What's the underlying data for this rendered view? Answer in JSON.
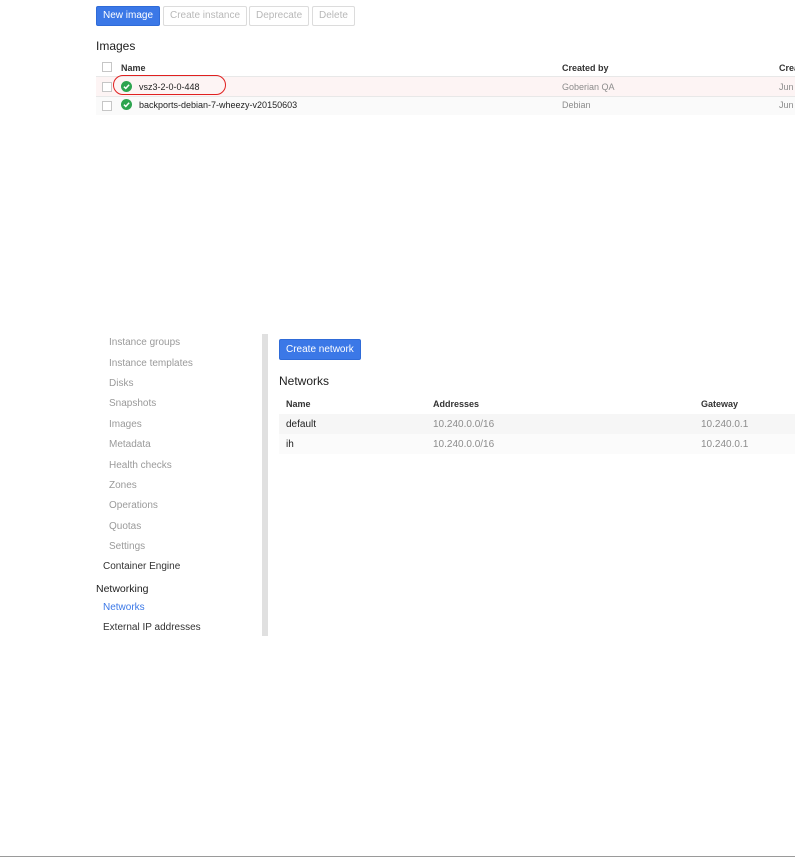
{
  "images_panel": {
    "toolbar": {
      "new_image": "New image",
      "create_instance": "Create instance",
      "deprecate": "Deprecate",
      "delete": "Delete"
    },
    "title": "Images",
    "columns": [
      "Name",
      "Created by",
      "Crea"
    ],
    "rows": [
      {
        "name": "vsz3-2-0-0-448",
        "created_by": "Goberian QA",
        "created": "Jun",
        "status": "ready"
      },
      {
        "name": "backports-debian-7-wheezy-v20150603",
        "created_by": "Debian",
        "created": "Jun",
        "status": "ready"
      }
    ]
  },
  "networking_panel": {
    "sidebar": {
      "compute_items": [
        "Instance groups",
        "Instance templates",
        "Disks",
        "Snapshots",
        "Images",
        "Metadata",
        "Health checks",
        "Zones",
        "Operations",
        "Quotas",
        "Settings"
      ],
      "container_engine": "Container Engine",
      "networking_header": "Networking",
      "networks": "Networks",
      "external_ip": "External IP addresses"
    },
    "create_button": "Create network",
    "title": "Networks",
    "columns": [
      "Name",
      "Addresses",
      "Gateway"
    ],
    "rows": [
      {
        "name": "default",
        "addresses": "10.240.0.0/16",
        "gateway": "10.240.0.1"
      },
      {
        "name": "ih",
        "addresses": "10.240.0.0/16",
        "gateway": "10.240.0.1"
      }
    ]
  },
  "colors": {
    "accent": "#3b78e7",
    "ok_green": "#2ea44f",
    "highlight": "#e02020"
  }
}
